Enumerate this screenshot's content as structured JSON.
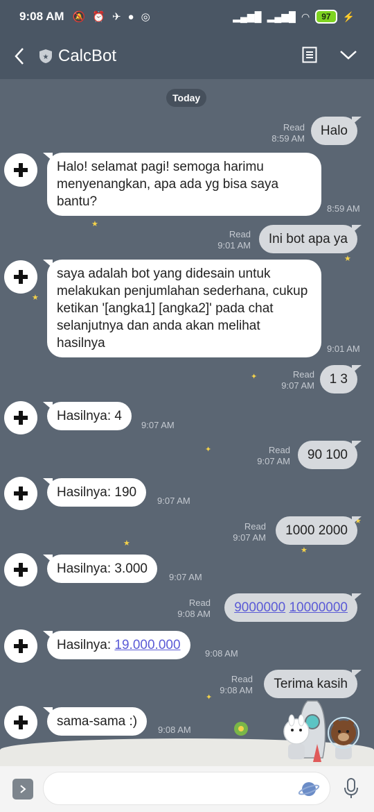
{
  "status": {
    "time": "9:08 AM",
    "battery": "97"
  },
  "header": {
    "title": "CalcBot"
  },
  "chat": {
    "date_label": "Today",
    "messages": [
      {
        "dir": "out",
        "text": "Halo",
        "read": "Read",
        "time": "8:59 AM"
      },
      {
        "dir": "in",
        "text": "Halo! selamat pagi! semoga harimu menyenangkan, apa ada yg bisa saya bantu?",
        "time": "8:59 AM"
      },
      {
        "dir": "out",
        "text": "Ini bot apa ya",
        "read": "Read",
        "time": "9:01 AM"
      },
      {
        "dir": "in",
        "text": "saya adalah bot yang didesain untuk melakukan penjumlahan sederhana, cukup ketikan '[angka1] [angka2]' pada chat selanjutnya dan anda akan melihat hasilnya",
        "time": "9:01 AM"
      },
      {
        "dir": "out",
        "text": "1 3",
        "read": "Read",
        "time": "9:07 AM"
      },
      {
        "dir": "in",
        "text": "Hasilnya: 4",
        "time": "9:07 AM"
      },
      {
        "dir": "out",
        "text": "90 100",
        "read": "Read",
        "time": "9:07 AM"
      },
      {
        "dir": "in",
        "text": "Hasilnya: 190",
        "time": "9:07 AM"
      },
      {
        "dir": "out",
        "text": "1000 2000",
        "read": "Read",
        "time": "9:07 AM"
      },
      {
        "dir": "in",
        "text": "Hasilnya: 3.000",
        "time": "9:07 AM"
      },
      {
        "dir": "out",
        "link1": "9000000",
        "link2": "10000000",
        "read": "Read",
        "time": "9:08 AM"
      },
      {
        "dir": "in",
        "prefix": "Hasilnya: ",
        "link": "19.000.000",
        "time": "9:08 AM"
      },
      {
        "dir": "out",
        "text": "Terima kasih",
        "read": "Read",
        "time": "9:08 AM"
      },
      {
        "dir": "in",
        "text": "sama-sama :)",
        "time": "9:08 AM"
      }
    ]
  },
  "icons": {
    "back": "back-arrow-icon",
    "shield": "shield-icon",
    "notes": "notes-icon",
    "menu": "chevron-down-icon",
    "avatar": "plus-icon",
    "expand": "chevron-right-icon",
    "emoji": "planet-icon",
    "mic": "microphone-icon"
  },
  "colors": {
    "header_bg": "#4a5664",
    "chat_bg": "#5b6673",
    "bubble_in": "#ffffff",
    "bubble_out": "#d6d9dd",
    "link": "#5a5ad6",
    "battery": "#7ed321"
  }
}
